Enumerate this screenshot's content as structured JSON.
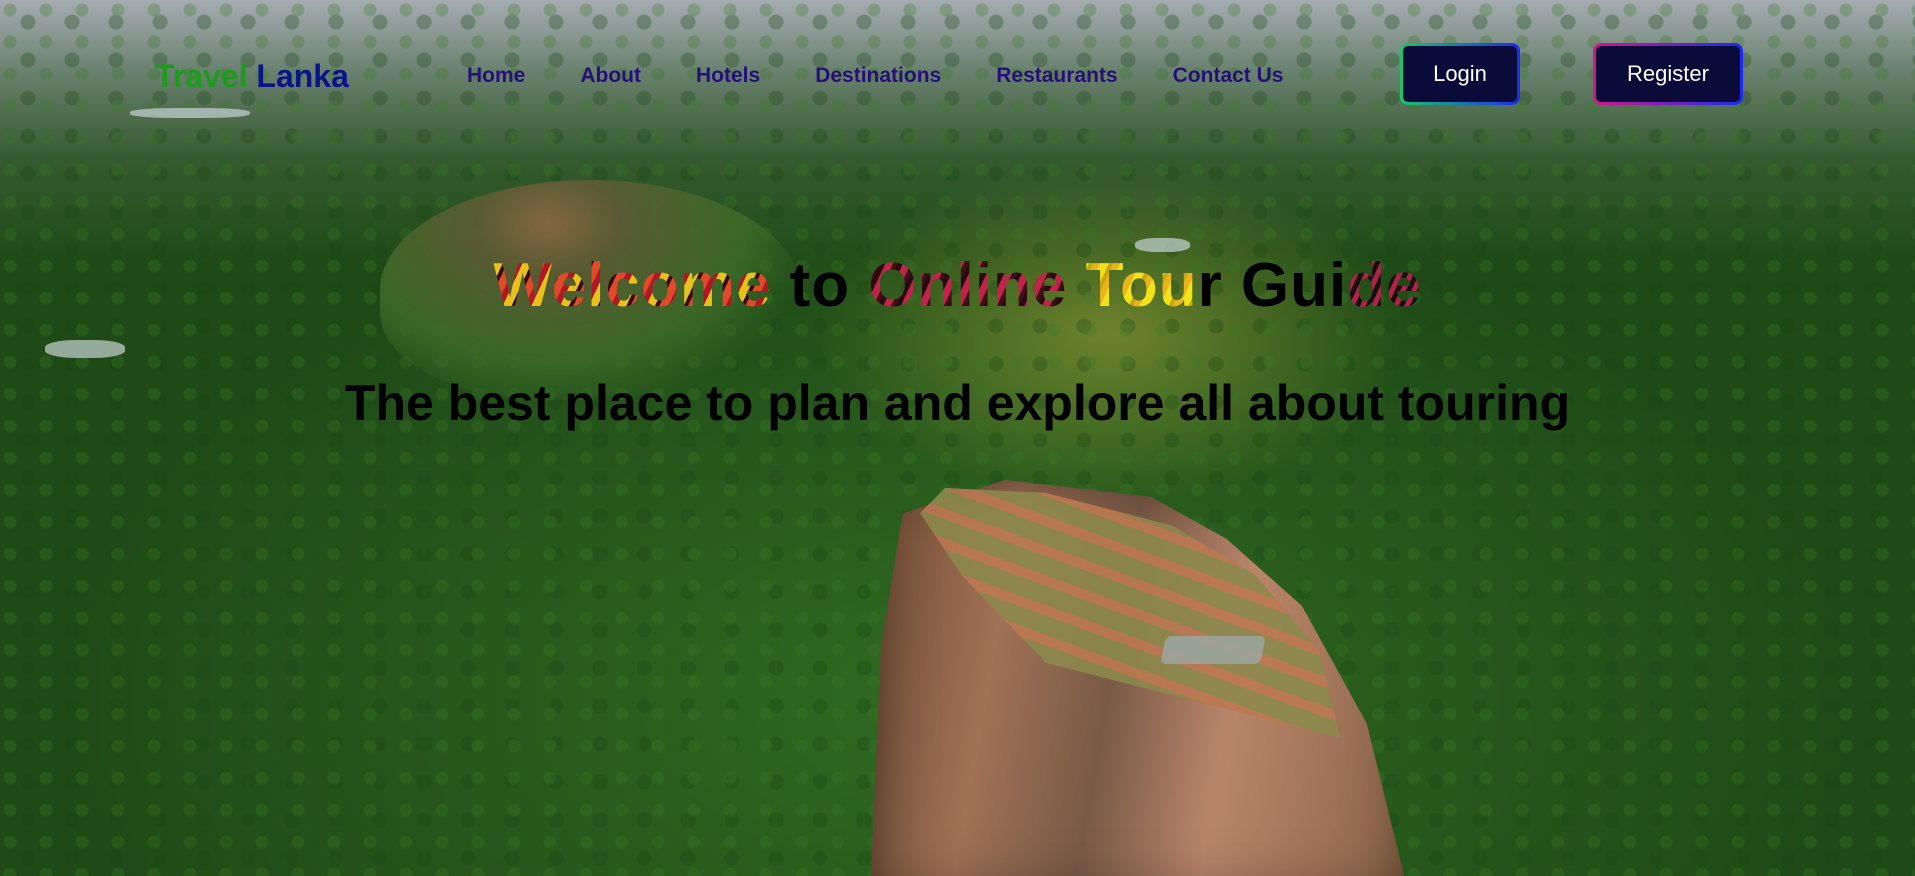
{
  "nav": {
    "logo_part1": "Travel",
    "logo_part2": "Lanka",
    "links": [
      "Home",
      "About",
      "Hotels",
      "Destinations",
      "Restaurants",
      "Contact Us"
    ],
    "login_label": "Login",
    "register_label": "Register"
  },
  "hero": {
    "headline_w1": "Welcome",
    "headline_to": " to ",
    "headline_w3": "Online",
    "headline_sp": " ",
    "headline_tou": "Tou",
    "headline_r": "r Gui",
    "headline_de": "de",
    "subline": "The best place to plan and explore all about touring"
  },
  "colors": {
    "logo_travel": "#1e9a1e",
    "logo_lanka": "#0a148a",
    "nav_link": "#25107a",
    "button_bg": "#0b0b3a"
  }
}
